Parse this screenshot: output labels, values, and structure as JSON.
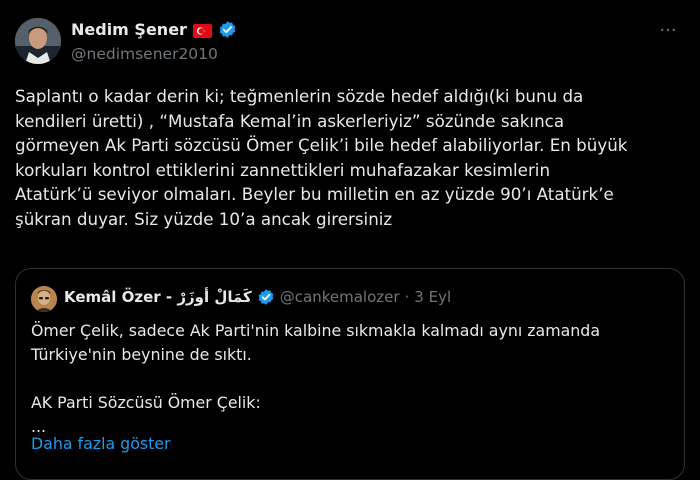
{
  "author": {
    "display_name": "Nedim Şener",
    "handle": "@nedimsener2010",
    "flag_icon": "turkey-flag-icon",
    "verified_icon": "verified-badge-icon"
  },
  "more_icon": "more-options-icon",
  "more_glyph": "···",
  "tweet": {
    "text": "Saplantı o kadar derin ki; teğmenlerin sözde hedef aldığı(ki bunu da\nkendileri üretti) , “Mustafa Kemal’in askerleriyiz” sözünde sakınca\ngörmeyen Ak Parti sözcüsü Ömer Çelik’i bile hedef alabiliyorlar. En büyük\nkorkuları kontrol ettiklerini zannettikleri  muhafazakar kesimlerin\nAtatürk’ü seviyor olmaları. Beyler bu milletin en az yüzde 90’ı Atatürk’e\nşükran duyar. Siz yüzde 10’a ancak girersiniz"
  },
  "quote": {
    "display_name": "Kemâl Özer - كَمَالْ أوزَرْ",
    "handle": "@cankemalozer",
    "separator": "·",
    "date": "3 Eyl",
    "lines": [
      "Ömer Çelik, sadece Ak Parti'nin kalbine sıkmakla kalmadı aynı zamanda",
      "Türkiye'nin beynine de sıktı.",
      "AK Parti Sözcüsü Ömer Çelik:",
      "..."
    ],
    "show_more": "Daha fazla göster"
  },
  "colors": {
    "background": "#000000",
    "text": "#e7e9ea",
    "muted": "#71767b",
    "link": "#1d9bf0",
    "verified": "#1d9bf0",
    "border": "#2f3336",
    "flag_red": "#e30a17"
  }
}
